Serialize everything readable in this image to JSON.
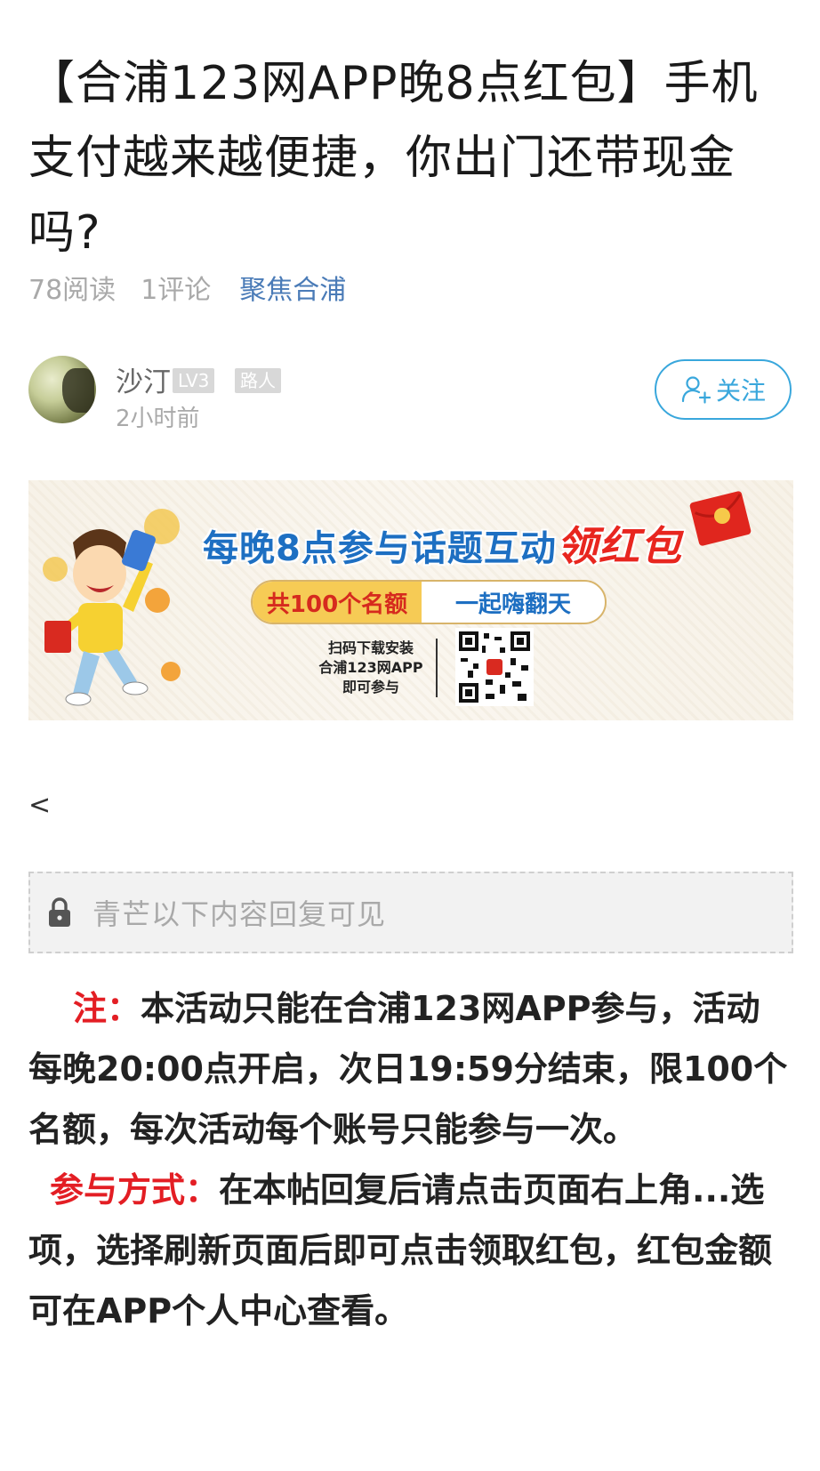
{
  "article": {
    "title": "【合浦123网APP晚8点红包】手机支付越来越便捷，你出门还带现金吗?",
    "read_count": "78阅读",
    "comment_count": "1评论",
    "forum": "聚焦合浦"
  },
  "author": {
    "name": "沙汀",
    "level": "LV3",
    "role": "路人",
    "time": "2小时前",
    "follow_label": "关注"
  },
  "banner": {
    "headline_main": "每晚8点参与话题互动",
    "headline_red": "领红包",
    "pill_left": "共100个名额",
    "pill_right": "一起嗨翻天",
    "scan_line1": "扫码下载安装",
    "scan_line2": "合浦123网APP",
    "scan_line3": "即可参与"
  },
  "content": {
    "back_symbol": "<",
    "locked_text": "青芒以下内容回复可见",
    "note_label": "注：",
    "note_text": "本活动只能在合浦123网APP参与，活动每晚20:00点开启，次日19:59分结束，限100个名额，每次活动每个账号只能参与一次。",
    "method_label": "参与方式：",
    "method_text": "在本帖回复后请点击页面右上角...选项，选择刷新页面后即可点击领取红包，红包金额可在APP个人中心查看。"
  },
  "colors": {
    "accent_blue": "#39a7dc",
    "link_blue": "#4a7bb7",
    "highlight_red": "#e31e24"
  }
}
